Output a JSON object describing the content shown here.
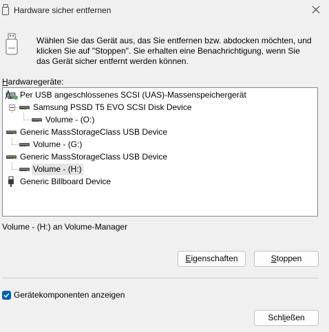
{
  "window": {
    "title": "Hardware sicher entfernen",
    "close_icon": "close-icon"
  },
  "instructions": "Wählen Sie das Gerät aus, das Sie entfernen bzw. abdocken möchten, und klicken Sie auf \"Stoppen\". Sie erhalten eine Benachrichtigung, wenn Sie das Gerät sicher entfernt werden können.",
  "hardware_label": {
    "accel": "H",
    "rest": "ardwaregeräte:"
  },
  "tree": [
    {
      "label": "Per USB angeschlossenes SCSI (UAS)-Massenspeichergerät",
      "icon": "usb-device-icon",
      "level": 0,
      "selected": false
    },
    {
      "label": "Samsung PSSD T5 EVO SCSI Disk Device",
      "icon": "drive-icon",
      "level": 1,
      "selected": false
    },
    {
      "label": "Volume - (O:)",
      "icon": "drive-icon",
      "level": 2,
      "selected": false
    },
    {
      "label": "Generic MassStorageClass USB Device",
      "icon": "drive-icon",
      "level": 0,
      "selected": false
    },
    {
      "label": "Volume - (G:)",
      "icon": "drive-icon",
      "level": 1,
      "selected": false
    },
    {
      "label": "Generic MassStorageClass USB Device",
      "icon": "drive-icon",
      "level": 0,
      "selected": false
    },
    {
      "label": "Volume - (H:)",
      "icon": "drive-icon",
      "level": 1,
      "selected": true
    },
    {
      "label": "Generic Billboard Device",
      "icon": "usb-plug-icon",
      "level": 0,
      "selected": false
    }
  ],
  "status_text": "Volume - (H:) an Volume-Manager",
  "buttons": {
    "properties": {
      "accel": "E",
      "rest": "igenschaften"
    },
    "stop": {
      "accel": "S",
      "rest": "toppen"
    },
    "close": {
      "pre": "Schl",
      "accel": "i",
      "rest": "eßen"
    }
  },
  "show_components": {
    "label": "Gerätekomponenten anzeigen",
    "checked": true
  },
  "colors": {
    "accent": "#005fb8",
    "selection": "#e5e5e5"
  }
}
